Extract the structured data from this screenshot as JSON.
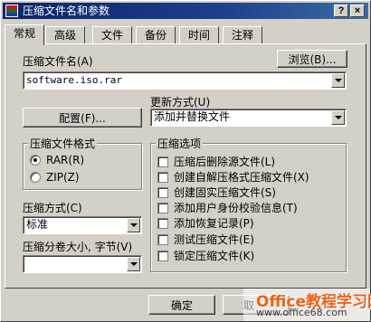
{
  "window": {
    "title": "压缩文件名和参数",
    "help": "?",
    "close": "×"
  },
  "tabs": [
    {
      "label": "常规",
      "active": true
    },
    {
      "label": "高级"
    },
    {
      "label": "文件"
    },
    {
      "label": "备份"
    },
    {
      "label": "时间"
    },
    {
      "label": "注释"
    }
  ],
  "general": {
    "archive_name_label": "压缩文件名(A)",
    "browse_button": "浏览(B)...",
    "archive_name_value": "software.iso.rar",
    "update_mode_label": "更新方式(U)",
    "profiles_button": "配置(F)...",
    "update_mode_value": "添加并替换文件",
    "format_group": {
      "title": "压缩文件格式",
      "options": [
        {
          "label": "RAR(R)",
          "selected": true
        },
        {
          "label": "ZIP(Z)",
          "selected": false
        }
      ]
    },
    "compression_label": "压缩方式(C)",
    "compression_value": "标准",
    "split_label": "压缩分卷大小, 字节(V)",
    "split_value": "",
    "options_group": {
      "title": "压缩选项",
      "items": [
        {
          "label": "压缩后删除源文件(L)",
          "checked": false
        },
        {
          "label": "创建自解压格式压缩文件(X)",
          "checked": false
        },
        {
          "label": "创建固实压缩文件(S)",
          "checked": false
        },
        {
          "label": "添加用户身份校验信息(T)",
          "checked": false
        },
        {
          "label": "添加恢复记录(P)",
          "checked": false
        },
        {
          "label": "测试压缩文件(E)",
          "checked": false
        },
        {
          "label": "锁定压缩文件(K)",
          "checked": false
        }
      ]
    }
  },
  "footer": {
    "ok_button": "确定",
    "cancel_button": "取"
  },
  "watermark": {
    "logo": "Office教程学习网",
    "url": "www.office68.com"
  },
  "colors": {
    "titlebar_start": "#0a246a",
    "titlebar_end": "#3a6ea5",
    "face": "#d4d0c8",
    "watermark_orange": "#e8641c"
  }
}
